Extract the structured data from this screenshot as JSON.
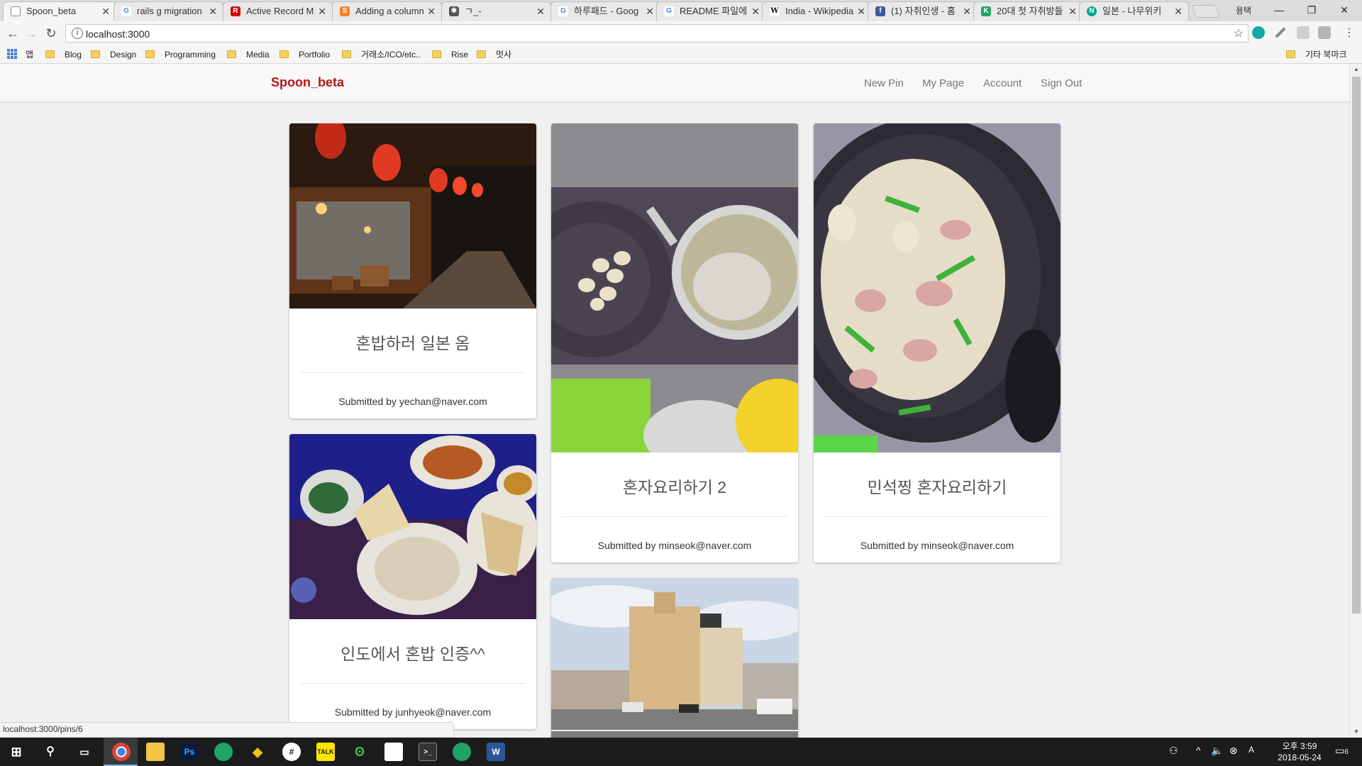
{
  "browser": {
    "tabs": [
      {
        "title": "Spoon_beta",
        "favicon": "page-icon",
        "color": "#888888"
      },
      {
        "title": "rails g migration",
        "favicon": "google-icon",
        "color": "#4285f4"
      },
      {
        "title": "Active Record M",
        "favicon": "rails-icon",
        "color": "#cc0000"
      },
      {
        "title": "Adding a column",
        "favicon": "stackoverflow-icon",
        "color": "#f48024"
      },
      {
        "title": "ㄱ_-",
        "favicon": "puzzle-icon",
        "color": "#555555"
      },
      {
        "title": "하루패드 - Goog",
        "favicon": "google-icon",
        "color": "#4285f4"
      },
      {
        "title": "README 파일에",
        "favicon": "google-icon",
        "color": "#4285f4"
      },
      {
        "title": "India - Wikipedia",
        "favicon": "wikipedia-icon",
        "color": "#333333"
      },
      {
        "title": "(1) 자취인생 - 홈",
        "favicon": "facebook-icon",
        "color": "#3b5998"
      },
      {
        "title": "20대 첫 자취방들",
        "favicon": "kakao-icon",
        "color": "#21a366"
      },
      {
        "title": "일본 - 나무위키",
        "favicon": "namu-icon",
        "color": "#00a495"
      }
    ],
    "profile_label": "용택",
    "url": "localhost:3000",
    "bookmarks": {
      "apps_label": "앱",
      "folders": [
        "Blog",
        "Design",
        "Programming",
        "Media",
        "Portfolio",
        "거래소/ICO/etc..",
        "Rise",
        "멋사"
      ],
      "other_label": "기타 북마크"
    },
    "status_url": "localhost:3000/pins/6"
  },
  "site": {
    "brand": "Spoon_beta",
    "brand_color": "#b01818",
    "nav": [
      "New Pin",
      "My Page",
      "Account",
      "Sign Out"
    ]
  },
  "pins": [
    {
      "title": "혼밥하러 일본 옴",
      "submitted": "Submitted by yechan@naver.com",
      "photo": "izakaya-street"
    },
    {
      "title": "인도에서 혼밥 인증^^",
      "submitted": "Submitted by junhyeok@naver.com",
      "photo": "indian-food-table"
    },
    {
      "title": "혼자요리하기 2",
      "submitted": "Submitted by minseok@naver.com",
      "photo": "colander-and-pot"
    },
    {
      "title": "",
      "submitted": "",
      "photo": "japanese-building-street"
    },
    {
      "title": "민석찡 혼자요리하기",
      "submitted": "Submitted by minseok@naver.com",
      "photo": "stir-fry-pan"
    }
  ],
  "taskbar": {
    "clock_time": "오후 3:59",
    "clock_date": "2018-05-24",
    "notification_count": "6",
    "lang": "A"
  }
}
